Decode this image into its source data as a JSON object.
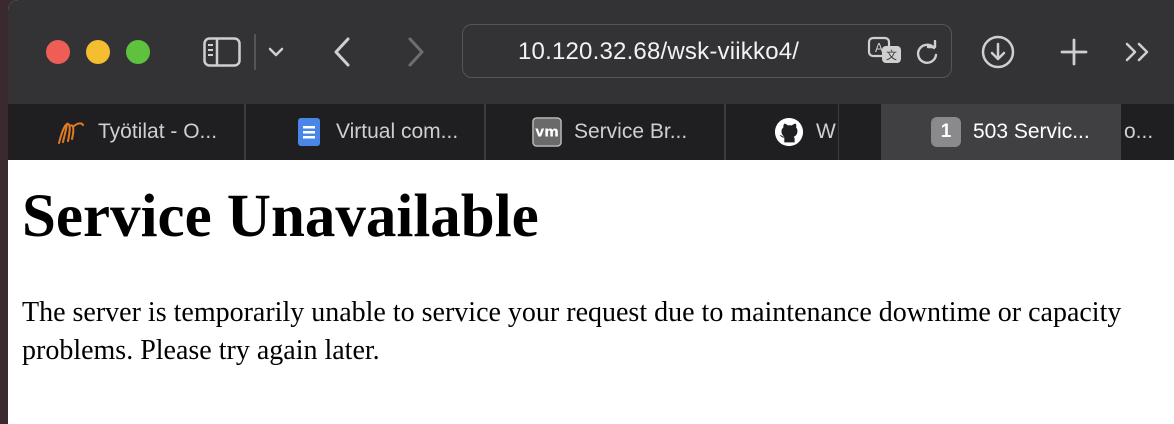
{
  "browser": {
    "address": "10.120.32.68/wsk-viikko4/",
    "tabs": [
      {
        "title": "Työtilat - O...",
        "icon": "moodle-icon",
        "active": false
      },
      {
        "title": "Virtual com...",
        "icon": "google-docs-icon",
        "active": false
      },
      {
        "title": "Service Br...",
        "icon": "vm-icon",
        "active": false
      },
      {
        "title": "W",
        "icon": "github-icon",
        "active": false
      },
      {
        "title": "503 Servic...",
        "badge": "1",
        "active": true
      },
      {
        "title": "o...",
        "active": false
      }
    ]
  },
  "page": {
    "heading": "Service Unavailable",
    "message": "The server is temporarily unable to service your request due to maintenance downtime or capacity problems. Please try again later."
  },
  "colors": {
    "toolbar": "#333335",
    "tabbar": "#1f1f21",
    "active_tab": "#404043",
    "close": "#ee5e57",
    "minimize": "#f5bd30",
    "zoom": "#5fc23f"
  }
}
